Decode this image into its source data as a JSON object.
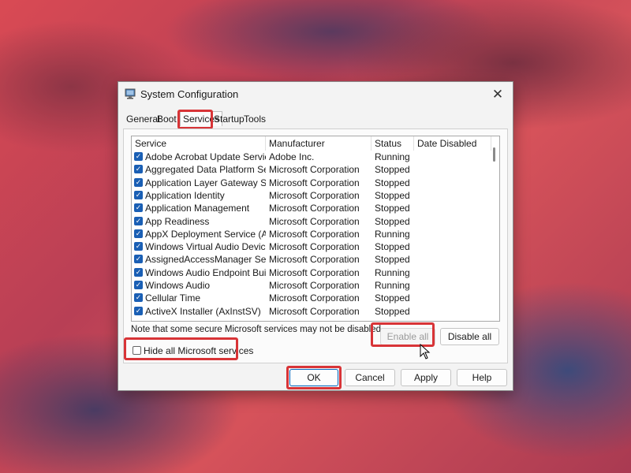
{
  "window": {
    "title": "System Configuration",
    "close_glyph": "✕",
    "app_icon": "monitor-icon"
  },
  "tabs": [
    {
      "label": "General"
    },
    {
      "label": "Boot"
    },
    {
      "label": "Services"
    },
    {
      "label": "Startup"
    },
    {
      "label": "Tools"
    }
  ],
  "active_tab": "Services",
  "columns": {
    "service": "Service",
    "manufacturer": "Manufacturer",
    "status": "Status",
    "date_disabled": "Date Disabled"
  },
  "rows": [
    {
      "service": "Adobe Acrobat Update Service",
      "manufacturer": "Adobe Inc.",
      "status": "Running",
      "checked": true
    },
    {
      "service": "Aggregated Data Platform Service",
      "manufacturer": "Microsoft Corporation",
      "status": "Stopped",
      "checked": true
    },
    {
      "service": "Application Layer Gateway Service",
      "manufacturer": "Microsoft Corporation",
      "status": "Stopped",
      "checked": true
    },
    {
      "service": "Application Identity",
      "manufacturer": "Microsoft Corporation",
      "status": "Stopped",
      "checked": true
    },
    {
      "service": "Application Management",
      "manufacturer": "Microsoft Corporation",
      "status": "Stopped",
      "checked": true
    },
    {
      "service": "App Readiness",
      "manufacturer": "Microsoft Corporation",
      "status": "Stopped",
      "checked": true
    },
    {
      "service": "AppX Deployment Service (AppXS...",
      "manufacturer": "Microsoft Corporation",
      "status": "Running",
      "checked": true
    },
    {
      "service": "Windows Virtual Audio Device Pro...",
      "manufacturer": "Microsoft Corporation",
      "status": "Stopped",
      "checked": true
    },
    {
      "service": "AssignedAccessManager Service",
      "manufacturer": "Microsoft Corporation",
      "status": "Stopped",
      "checked": true
    },
    {
      "service": "Windows Audio Endpoint Builder",
      "manufacturer": "Microsoft Corporation",
      "status": "Running",
      "checked": true
    },
    {
      "service": "Windows Audio",
      "manufacturer": "Microsoft Corporation",
      "status": "Running",
      "checked": true
    },
    {
      "service": "Cellular Time",
      "manufacturer": "Microsoft Corporation",
      "status": "Stopped",
      "checked": true
    },
    {
      "service": "ActiveX Installer (AxInstSV)",
      "manufacturer": "Microsoft Corporation",
      "status": "Stopped",
      "checked": true
    }
  ],
  "note": "Note that some secure Microsoft services may not be disabled.",
  "buttons": {
    "enable_all": "Enable all",
    "disable_all": "Disable all",
    "ok": "OK",
    "cancel": "Cancel",
    "apply": "Apply",
    "help": "Help"
  },
  "hide_ms": {
    "label": "Hide all Microsoft services",
    "checked": false
  },
  "colors": {
    "highlight": "#d83437",
    "checkbox": "#1a5fb4"
  }
}
